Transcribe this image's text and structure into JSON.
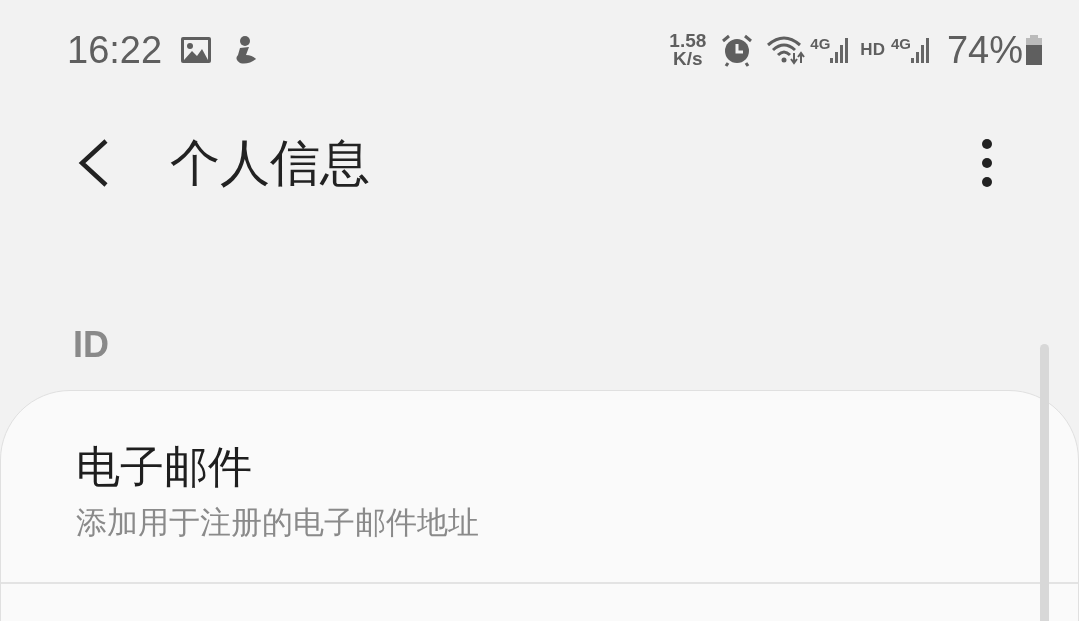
{
  "status_bar": {
    "time": "16:22",
    "speed_value": "1.58",
    "speed_unit": "K/s",
    "network_1": "4G",
    "hd": "HD",
    "network_2": "4G",
    "battery": "74%"
  },
  "header": {
    "title": "个人信息"
  },
  "section": {
    "title": "ID"
  },
  "items": [
    {
      "title": "电子邮件",
      "subtitle": "添加用于注册的电子邮件地址"
    }
  ]
}
